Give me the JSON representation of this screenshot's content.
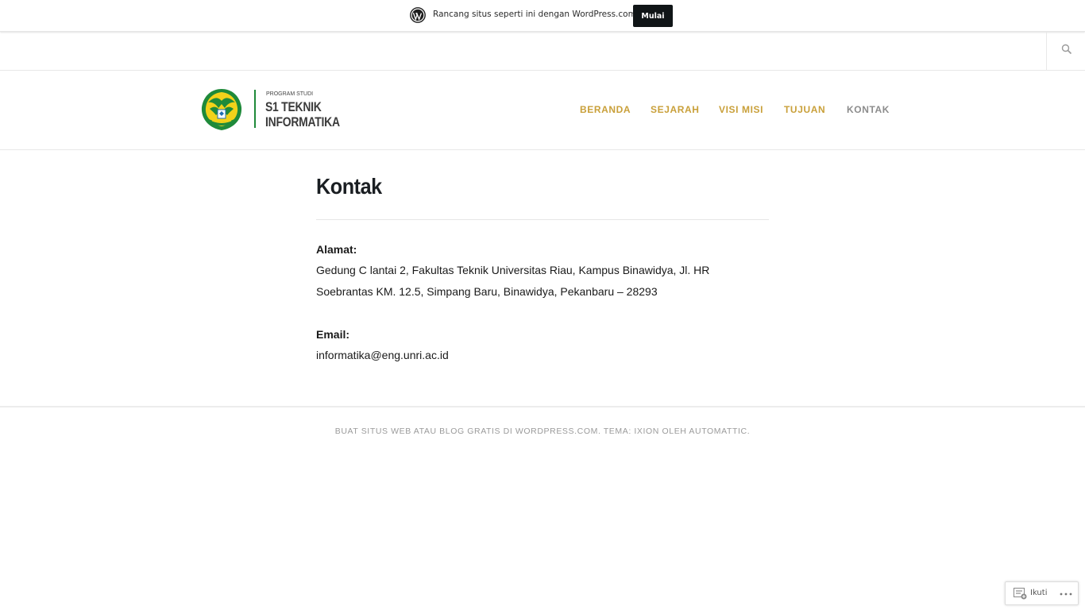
{
  "promo_bar": {
    "text": "Rancang situs seperti ini dengan WordPress.com",
    "button_label": "Mulai",
    "icon": "wordpress-logo-icon"
  },
  "search": {
    "icon": "search-icon"
  },
  "site": {
    "logo_small": "PROGRAM STUDI",
    "logo_line1": "S1 TEKNIK",
    "logo_line2": "INFORMATIKA",
    "emblem_colors": {
      "green": "#1f8a3a",
      "yellow": "#f2d21a"
    }
  },
  "nav": {
    "items": [
      {
        "label": "BERANDA"
      },
      {
        "label": "SEJARAH"
      },
      {
        "label": "VISI MISI"
      },
      {
        "label": "TUJUAN"
      },
      {
        "label": "KONTAK"
      }
    ],
    "active_color": "#8c8c8c",
    "link_color": "#c9a03a"
  },
  "page": {
    "title": "Kontak",
    "address_label": "Alamat:",
    "address_line1": "Gedung C lantai 2, Fakultas Teknik Universitas Riau, Kampus Binawidya, Jl. HR",
    "address_line2": "Soebrantas KM. 12.5, Simpang Baru, Binawidya, Pekanbaru – 28293",
    "email_label": "Email:",
    "email_value": "informatika@eng.unri.ac.id"
  },
  "footer": {
    "text": "BUAT SITUS WEB ATAU BLOG GRATIS DI WORDPRESS.COM. TEMA: IXION OLEH AUTOMATTIC."
  },
  "follow_widget": {
    "label": "Ikuti",
    "icon": "follow-reader-icon",
    "more_icon": "more-dots-icon"
  }
}
